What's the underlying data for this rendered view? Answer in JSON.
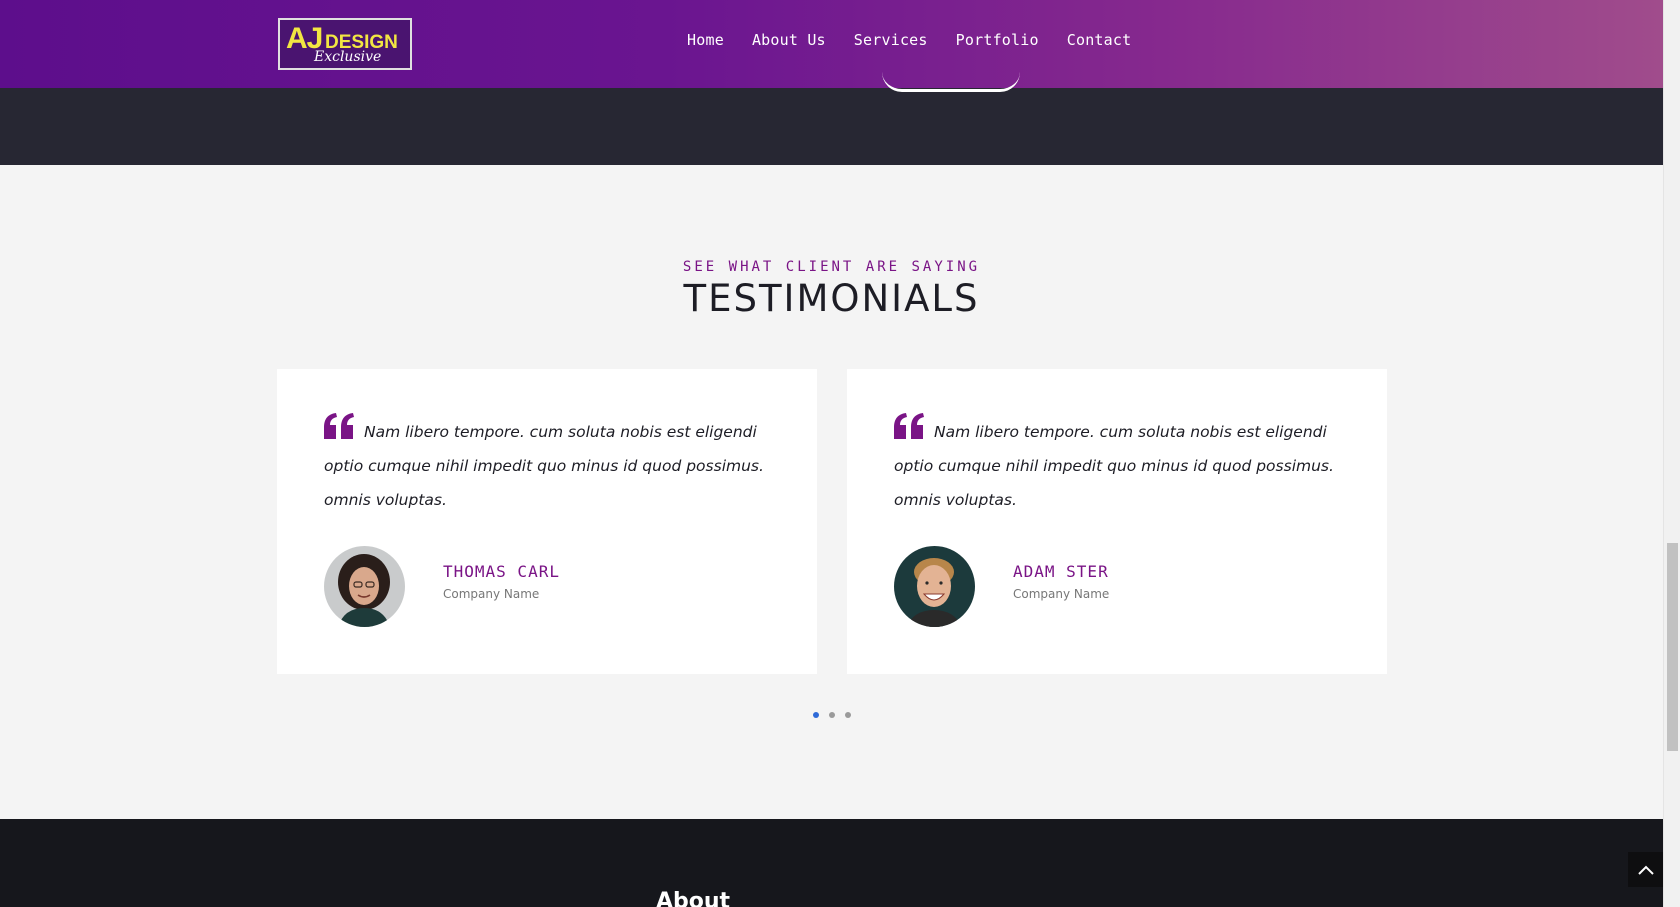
{
  "header": {
    "logo": {
      "primary": "AJ",
      "secondary": "DESIGN",
      "script": "Exclusive"
    },
    "nav": [
      {
        "label": "Home"
      },
      {
        "label": "About Us"
      },
      {
        "label": "Services"
      },
      {
        "label": "Portfolio"
      },
      {
        "label": "Contact"
      }
    ]
  },
  "testimonials": {
    "kicker": "SEE WHAT CLIENT ARE SAYING",
    "title": "TESTIMONIALS",
    "cards": [
      {
        "quote": "Nam libero tempore. cum soluta nobis est eligendi optio cumque nihil impedit quo minus id quod possimus. omnis voluptas.",
        "name": "THOMAS CARL",
        "company": "Company Name"
      },
      {
        "quote": "Nam libero tempore. cum soluta nobis est eligendi optio cumque nihil impedit quo minus id quod possimus. omnis voluptas.",
        "name": "ADAM STER",
        "company": "Company Name"
      }
    ],
    "pagination": {
      "total": 3,
      "active": 1
    }
  },
  "footer": {
    "title": "About"
  },
  "colors": {
    "accent": "#7a1486",
    "header_gradient_start": "#5d0e8c",
    "header_gradient_end": "#a04c8c",
    "dark": "#16171c",
    "dot_active": "#2e6ad8"
  },
  "icons": {
    "quote": "quote-icon",
    "back_to_top": "chevron-up-icon"
  }
}
